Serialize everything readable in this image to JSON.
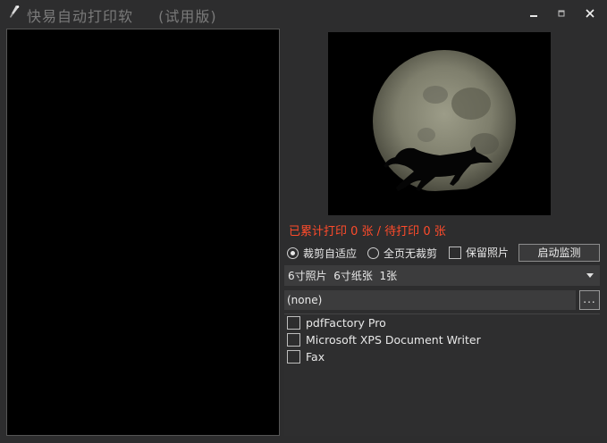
{
  "window": {
    "title": "快易自动打印软",
    "title_suffix": "(试用版)",
    "minimize_label": "▁",
    "maximize_label": "▫",
    "close_label": "✕"
  },
  "preview": {},
  "photo": {},
  "status": {
    "counter_text": "已累计打印 0 张 / 待打印 0 张",
    "counter_color": "#ff4b2b"
  },
  "options": {
    "fit_label": "裁剪自适应",
    "fit_selected": true,
    "full_label": "全页无裁剪",
    "full_selected": false,
    "keep_label": "保留照片",
    "keep_checked": false,
    "start_button": "启动监测"
  },
  "size_select": {
    "value": "6寸照片  6寸纸张  1张"
  },
  "folder": {
    "value": "(none)",
    "browse_label": "..."
  },
  "printers": [
    {
      "name": "pdfFactory Pro",
      "checked": false
    },
    {
      "name": "Microsoft XPS Document Writer",
      "checked": false
    },
    {
      "name": "Fax",
      "checked": false
    }
  ]
}
